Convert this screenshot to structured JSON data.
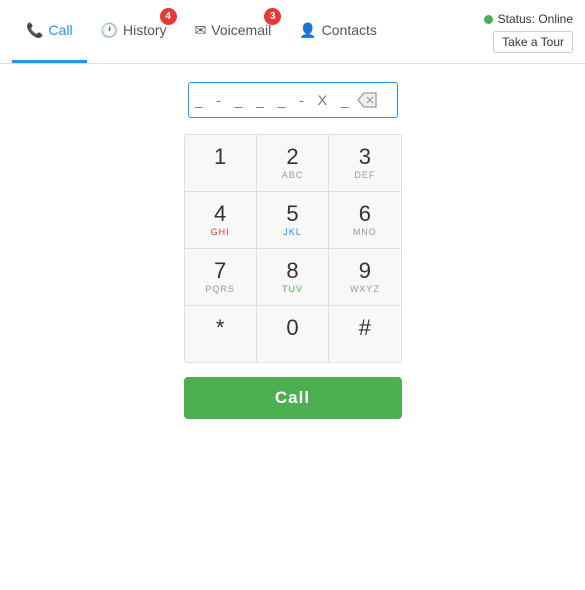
{
  "status": {
    "label": "Status: Online",
    "dot_color": "#4caf50"
  },
  "tour_button": "Take a Tour",
  "tabs": [
    {
      "id": "call",
      "label": "Call",
      "icon": "📞",
      "badge": null,
      "active": true
    },
    {
      "id": "history",
      "label": "History",
      "icon": "🕐",
      "badge": "4",
      "active": false
    },
    {
      "id": "voicemail",
      "label": "Voicemail",
      "icon": "✉",
      "badge": "3",
      "active": false
    },
    {
      "id": "contacts",
      "label": "Contacts",
      "icon": "👤",
      "badge": null,
      "active": false
    }
  ],
  "phone_input": {
    "placeholder": "_  -  _  _  _  -  X  _  _  _  _",
    "value": ""
  },
  "dialpad": {
    "rows": [
      [
        {
          "number": "1",
          "letters": ""
        },
        {
          "number": "2",
          "letters": "ABC",
          "letters_class": ""
        },
        {
          "number": "3",
          "letters": "DEF",
          "letters_class": ""
        }
      ],
      [
        {
          "number": "4",
          "letters": "GHI",
          "letters_class": "red"
        },
        {
          "number": "5",
          "letters": "JKL",
          "letters_class": "blue"
        },
        {
          "number": "6",
          "letters": "MNO",
          "letters_class": ""
        }
      ],
      [
        {
          "number": "7",
          "letters": "PQRS",
          "letters_class": ""
        },
        {
          "number": "8",
          "letters": "TUV",
          "letters_class": "green"
        },
        {
          "number": "9",
          "letters": "WXYZ",
          "letters_class": ""
        }
      ],
      [
        {
          "number": "*",
          "letters": ""
        },
        {
          "number": "0",
          "letters": ""
        },
        {
          "number": "#",
          "letters": ""
        }
      ]
    ]
  },
  "call_button_label": "Call"
}
